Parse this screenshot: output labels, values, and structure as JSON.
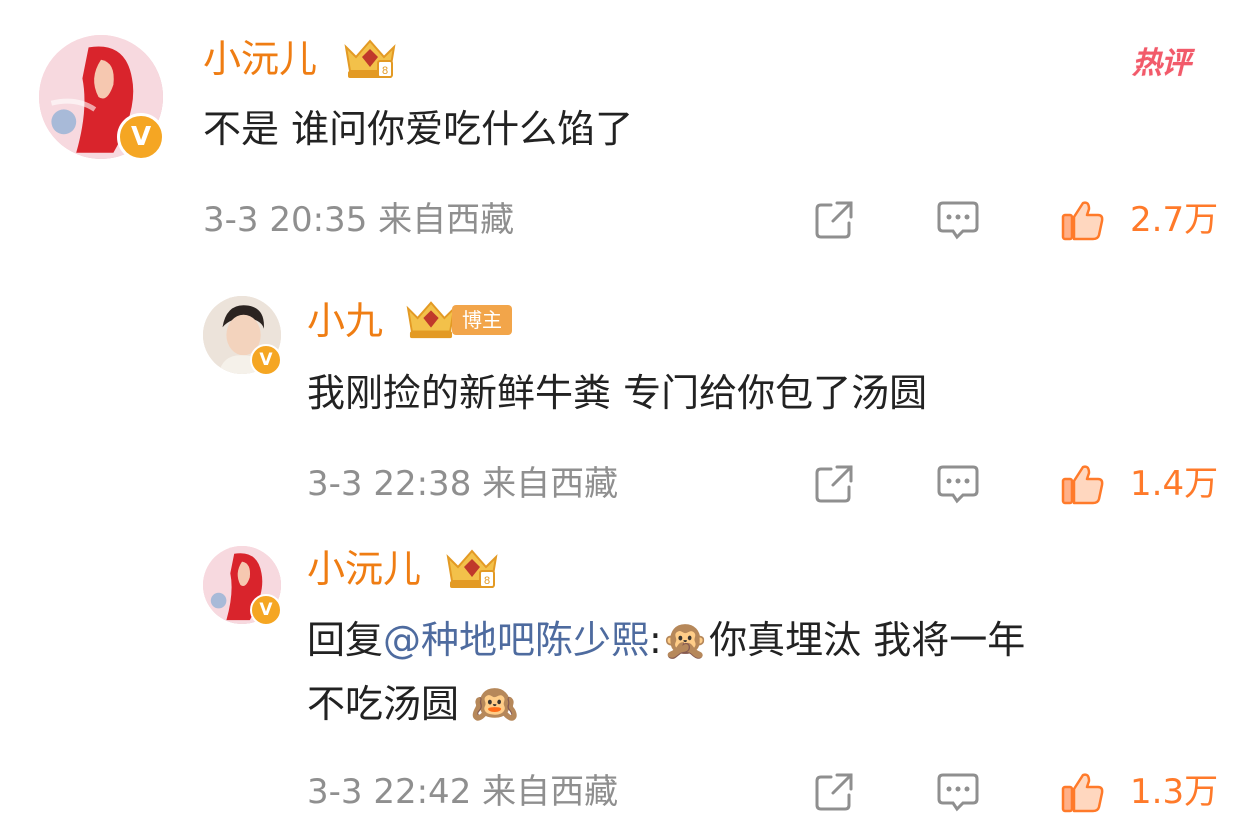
{
  "comment_main": {
    "username": "小沅儿",
    "text": "不是 谁问你爱吃什么馅了",
    "meta": "3-3 20:35 来自西藏",
    "likes": "2.7万",
    "hot_label": "热评"
  },
  "reply_1": {
    "username": "小九",
    "badge": "博主",
    "text": "我刚捡的新鲜牛粪 专门给你包了汤圆",
    "meta": "3-3 22:38 来自西藏",
    "likes": "1.4万"
  },
  "reply_2": {
    "username": "小沅儿",
    "text_prefix": "回复",
    "mention": "@种地吧陈少熙",
    "text_line1_after_mention": ":🙊你真埋汰 我将一年",
    "text_line2": "不吃汤圆 🙉",
    "meta": "3-3 22:42 来自西藏",
    "likes": "1.3万"
  },
  "icons": {
    "share": "share-icon",
    "comment": "comment-icon",
    "like": "thumbs-up-icon",
    "verified": "verified-v-icon",
    "crown": "crown-vip-icon"
  },
  "colors": {
    "username": "#ef7d13",
    "like": "#ff7a2a",
    "mention": "#4e6b9f",
    "meta": "#8f8f8f",
    "hot": "#f25a6a"
  }
}
